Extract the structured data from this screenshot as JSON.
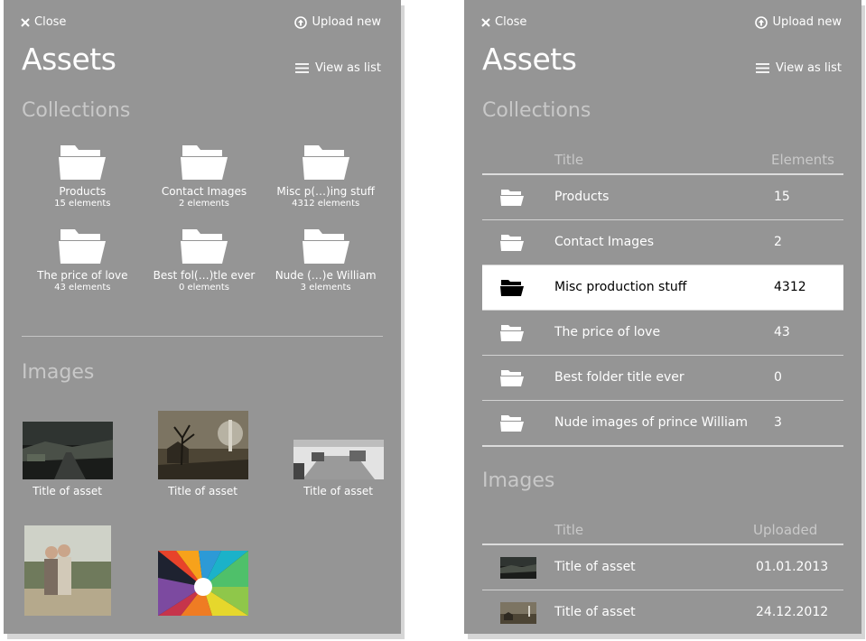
{
  "topbar": {
    "close_label": "Close",
    "upload_label": "Upload new"
  },
  "header": {
    "title": "Assets",
    "view_as_list_label": "View as list"
  },
  "collections_heading": "Collections",
  "images_heading": "Images",
  "grid_collections": [
    {
      "title": "Products",
      "count": "15 elements"
    },
    {
      "title": "Contact Images",
      "count": "2 elements"
    },
    {
      "title": "Misc p(…)ing stuff",
      "count": "4312 elements"
    },
    {
      "title": "The price of love",
      "count": "43 elements"
    },
    {
      "title": "Best fol(…)tle ever",
      "count": "0 elements"
    },
    {
      "title": "Nude (…)e William",
      "count": "3 elements"
    }
  ],
  "grid_images": [
    {
      "title": "Title of asset"
    },
    {
      "title": "Title of asset"
    },
    {
      "title": "Title of asset"
    }
  ],
  "list_collections": {
    "headers": {
      "title": "Title",
      "elements": "Elements"
    },
    "rows": [
      {
        "title": "Products",
        "elements": "15"
      },
      {
        "title": "Contact Images",
        "elements": "2"
      },
      {
        "title": "Misc production stuff",
        "elements": "4312"
      },
      {
        "title": "The price of love",
        "elements": "43"
      },
      {
        "title": "Best folder title ever",
        "elements": "0"
      },
      {
        "title": "Nude images of prince William",
        "elements": "3"
      }
    ]
  },
  "list_images": {
    "headers": {
      "title": "Title",
      "uploaded": "Uploaded"
    },
    "rows": [
      {
        "title": "Title of asset",
        "uploaded": "01.01.2013"
      },
      {
        "title": "Title of asset",
        "uploaded": "24.12.2012"
      }
    ]
  },
  "colors": {
    "panel_bg": "#959595",
    "selected_row_bg": "#ffffff",
    "heading_muted": "#c8c8c8"
  }
}
